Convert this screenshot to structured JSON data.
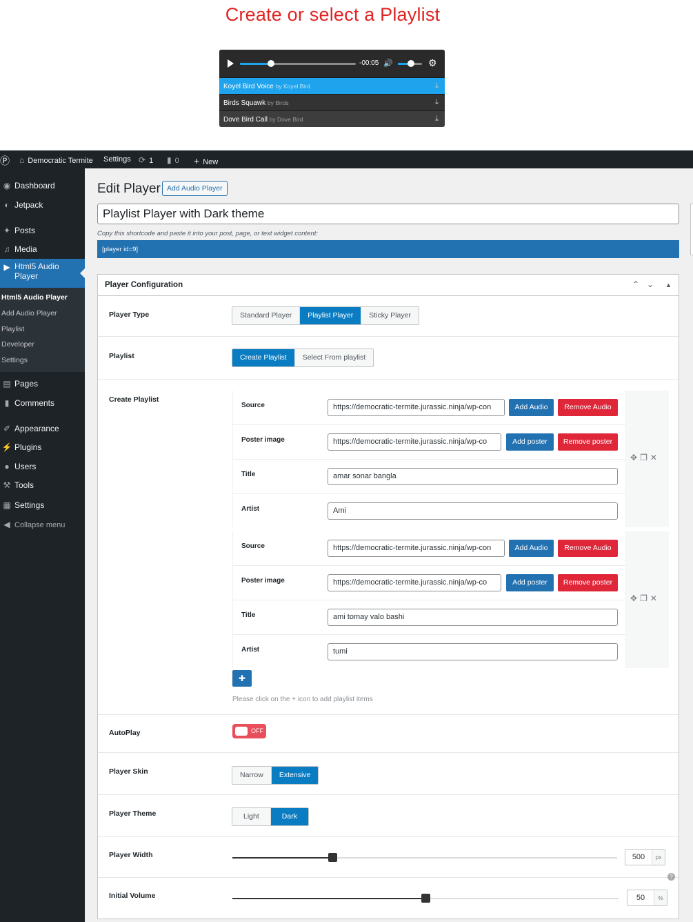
{
  "hero": {
    "title": "Create or select a Playlist",
    "player": {
      "time": "-00:05",
      "progress": 0.27,
      "volume": 0.55,
      "tracks": [
        {
          "title": "Koyel Bird Voice",
          "by": "by Koyel Bird",
          "active": true
        },
        {
          "title": "Birds Squawk",
          "by": "by Birds",
          "active": false
        },
        {
          "title": "Dove Bird Call",
          "by": "by Dove Bird",
          "active": false
        }
      ]
    }
  },
  "adminbar": {
    "site_name": "Democratic Termite",
    "settings": "Settings",
    "updates": "1",
    "comments": "0",
    "new": "New"
  },
  "sidebar": {
    "items": [
      {
        "label": "Dashboard",
        "icon": "dashboard-icon"
      },
      {
        "label": "Jetpack",
        "icon": "jetpack-icon"
      },
      {
        "label": "Posts",
        "icon": "pin-icon"
      },
      {
        "label": "Media",
        "icon": "media-icon"
      },
      {
        "label": "Html5 Audio Player",
        "icon": "play-circle-icon"
      },
      {
        "label": "Pages",
        "icon": "page-icon"
      },
      {
        "label": "Comments",
        "icon": "comment-icon"
      },
      {
        "label": "Appearance",
        "icon": "brush-icon"
      },
      {
        "label": "Plugins",
        "icon": "plugin-icon"
      },
      {
        "label": "Users",
        "icon": "user-icon"
      },
      {
        "label": "Tools",
        "icon": "wrench-icon"
      },
      {
        "label": "Settings",
        "icon": "settings-icon"
      },
      {
        "label": "Collapse menu",
        "icon": "collapse-icon"
      }
    ],
    "submenu": [
      "Html5 Audio Player",
      "Add Audio Player",
      "Playlist",
      "Developer",
      "Settings"
    ]
  },
  "page": {
    "heading": "Edit Player",
    "add_button": "Add Audio Player",
    "title_value": "Playlist Player with Dark theme",
    "shortcode_hint": "Copy this shortcode and paste it into your post, page, or text widget content:",
    "shortcode": "[player id=9]"
  },
  "config": {
    "title": "Player Configuration",
    "player_type": {
      "label": "Player Type",
      "options": [
        "Standard Player",
        "Playlist Player",
        "Sticky Player"
      ],
      "selected": "Playlist Player"
    },
    "playlist": {
      "label": "Playlist",
      "options": [
        "Create Playlist",
        "Select From playlist"
      ],
      "selected": "Create Playlist"
    },
    "create_playlist": {
      "label": "Create Playlist",
      "field_labels": {
        "source": "Source",
        "poster": "Poster image",
        "title": "Title",
        "artist": "Artist"
      },
      "buttons": {
        "add_audio": "Add Audio",
        "remove_audio": "Remove Audio",
        "add_poster": "Add poster",
        "remove_poster": "Remove poster"
      },
      "items": [
        {
          "source": "https://democratic-termite.jurassic.ninja/wp-con",
          "poster": "https://democratic-termite.jurassic.ninja/wp-co",
          "title": "amar sonar bangla",
          "artist": "Ami"
        },
        {
          "source": "https://democratic-termite.jurassic.ninja/wp-con",
          "poster": "https://democratic-termite.jurassic.ninja/wp-co",
          "title": "ami tomay valo bashi",
          "artist": "tumi"
        }
      ],
      "add_hint": "Please click on the + icon to add playlist items"
    },
    "autoplay": {
      "label": "AutoPlay",
      "state": "OFF"
    },
    "skin": {
      "label": "Player Skin",
      "options": [
        "Narrow",
        "Extensive"
      ],
      "selected": "Extensive"
    },
    "theme": {
      "label": "Player Theme",
      "options": [
        "Light",
        "Dark"
      ],
      "selected": "Dark"
    },
    "width": {
      "label": "Player Width",
      "value": "500",
      "unit": "px",
      "fraction": 0.26
    },
    "volume": {
      "label": "Initial Volume",
      "value": "50",
      "unit": "%",
      "fraction": 0.5
    }
  }
}
